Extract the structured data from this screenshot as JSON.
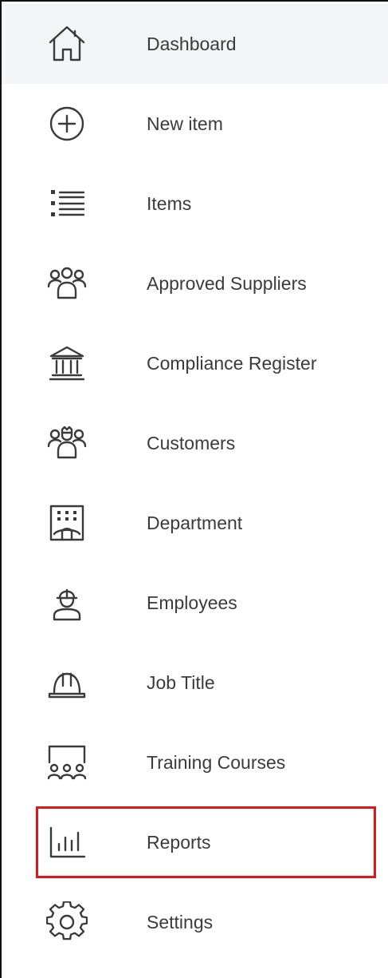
{
  "sidebar": {
    "items": [
      {
        "key": "dashboard",
        "label": "Dashboard",
        "icon": "home-icon",
        "active": true
      },
      {
        "key": "new-item",
        "label": "New item",
        "icon": "plus-circle-icon"
      },
      {
        "key": "items",
        "label": "Items",
        "icon": "list-icon"
      },
      {
        "key": "approved-suppliers",
        "label": "Approved Suppliers",
        "icon": "people-group-icon"
      },
      {
        "key": "compliance-register",
        "label": "Compliance Register",
        "icon": "bank-icon"
      },
      {
        "key": "customers",
        "label": "Customers",
        "icon": "customers-icon"
      },
      {
        "key": "department",
        "label": "Department",
        "icon": "building-icon"
      },
      {
        "key": "employees",
        "label": "Employees",
        "icon": "worker-icon"
      },
      {
        "key": "job-title",
        "label": "Job Title",
        "icon": "hard-hat-icon"
      },
      {
        "key": "training-courses",
        "label": "Training Courses",
        "icon": "training-icon"
      },
      {
        "key": "reports",
        "label": "Reports",
        "icon": "bar-chart-icon",
        "highlighted": true
      },
      {
        "key": "settings",
        "label": "Settings",
        "icon": "gear-icon"
      }
    ]
  },
  "colors": {
    "active_background": "#f4f5f7",
    "highlight_outline": "#e0161d",
    "text": "#3b3b3b",
    "icon": "#3a3a3a"
  }
}
